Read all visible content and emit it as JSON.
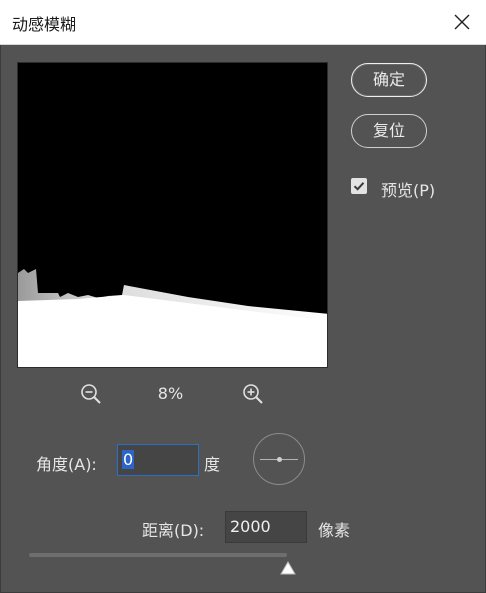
{
  "dialog": {
    "title": "动感模糊"
  },
  "buttons": {
    "ok_label": "确定",
    "reset_label": "复位"
  },
  "preview": {
    "label": "预览(P)",
    "checked": true
  },
  "zoom": {
    "value": "8%"
  },
  "angle": {
    "label": "角度(A):",
    "value": "0",
    "unit": "度"
  },
  "distance": {
    "label": "距离(D):",
    "value": "2000",
    "unit": "像素"
  },
  "icons": {
    "close": "close-icon",
    "zoom_out": "zoom-out-icon",
    "zoom_in": "zoom-in-icon",
    "checkmark": "checkmark-icon",
    "slider_thumb": "triangle-up-icon"
  },
  "colors": {
    "dialog_bg": "#535353",
    "title_bg": "#ffffff",
    "focus_blue": "#2d6fc5"
  }
}
